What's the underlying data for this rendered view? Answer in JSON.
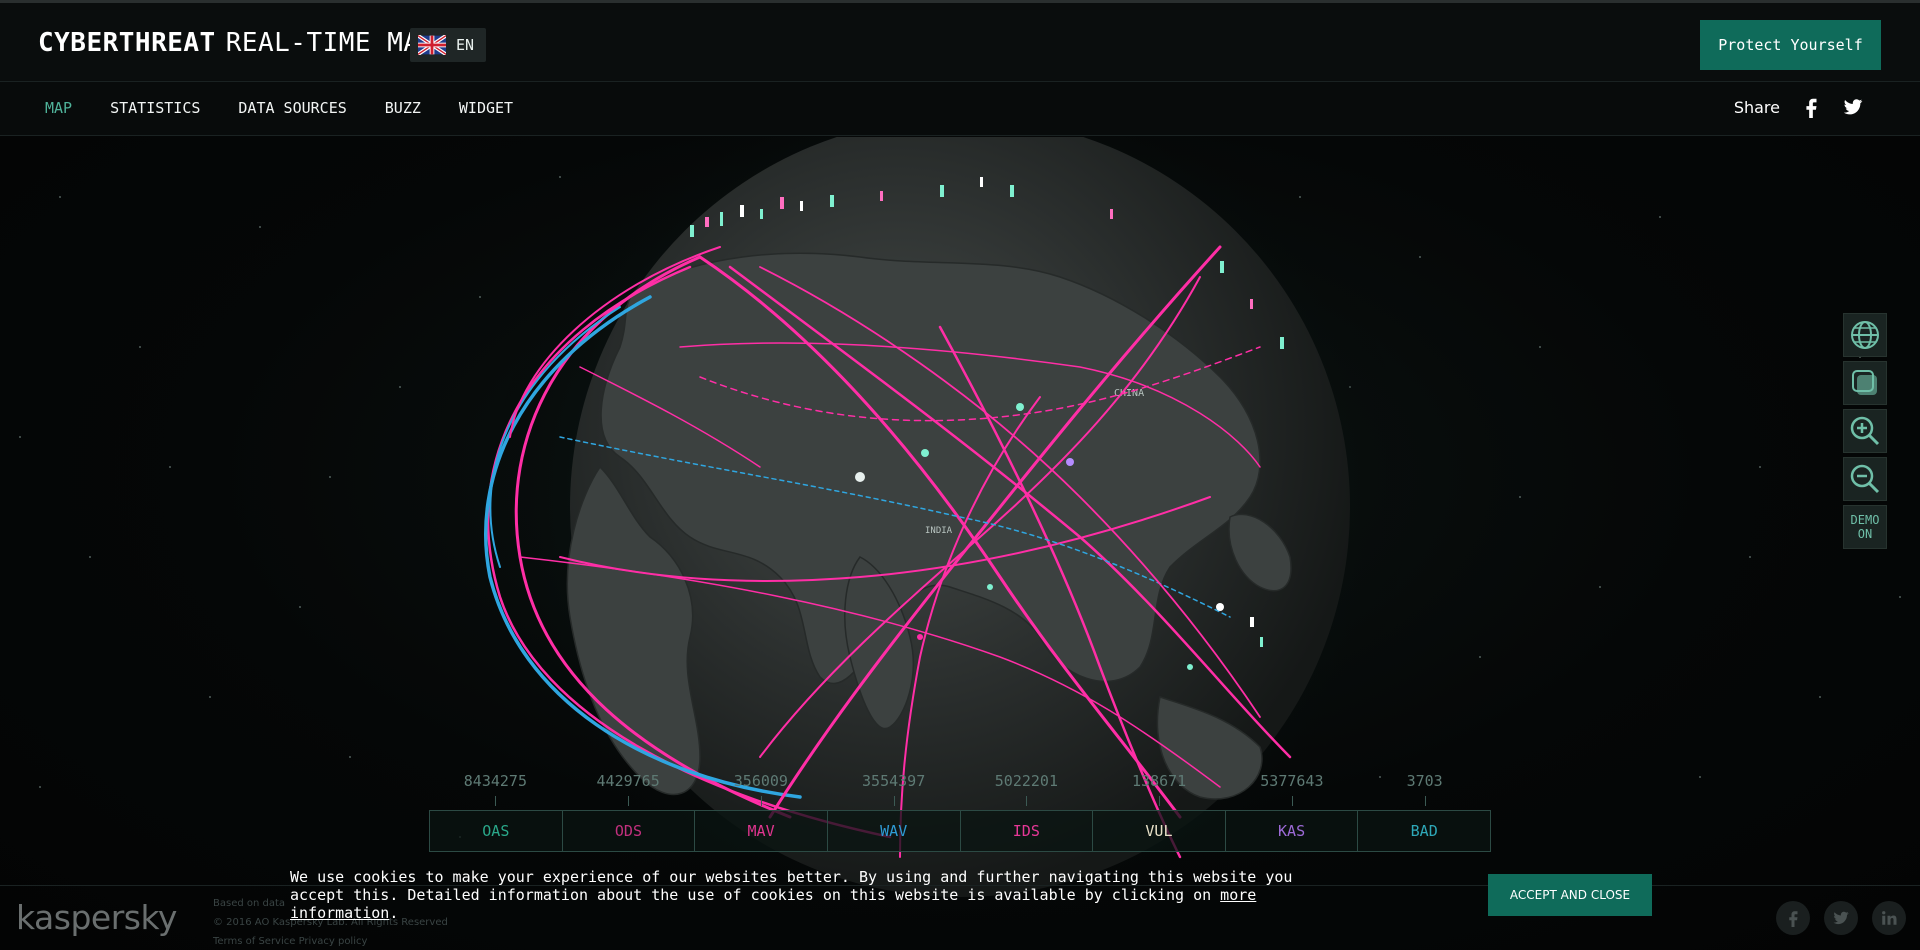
{
  "header": {
    "brand_bold": "CYBERTHREAT",
    "brand_rest": "REAL-TIME MAP",
    "language": "EN",
    "protect_button": "Protect Yourself"
  },
  "nav": {
    "items": [
      {
        "label": "MAP",
        "active": true
      },
      {
        "label": "STATISTICS",
        "active": false
      },
      {
        "label": "DATA SOURCES",
        "active": false
      },
      {
        "label": "BUZZ",
        "active": false
      },
      {
        "label": "WIDGET",
        "active": false
      }
    ],
    "share_label": "Share"
  },
  "map": {
    "labels": {
      "china": "CHINA",
      "india": "INDIA"
    },
    "controls": {
      "demo_label": "DEMO\nON"
    }
  },
  "counters": [
    {
      "value": "8434275",
      "label": "OAS",
      "color": "#2aa88a"
    },
    {
      "value": "4429765",
      "label": "ODS",
      "color": "#c2307e"
    },
    {
      "value": "356009",
      "label": "MAV",
      "color": "#e0358f"
    },
    {
      "value": "3554397",
      "label": "WAV",
      "color": "#2f9bd6"
    },
    {
      "value": "5022201",
      "label": "IDS",
      "color": "#e63897"
    },
    {
      "value": "138671",
      "label": "VUL",
      "color": "#e8e1c8"
    },
    {
      "value": "5377643",
      "label": "KAS",
      "color": "#9c6ad6"
    },
    {
      "value": "3703",
      "label": "BAD",
      "color": "#2ea8b8"
    }
  ],
  "cookie": {
    "text_before": "We use cookies to make your experience of our websites better. By using and further navigating this website you accept this. Detailed information about the use of cookies on this website is available by clicking on ",
    "link": "more information",
    "text_after": ".",
    "button": "ACCEPT AND CLOSE"
  },
  "footer": {
    "logo": "kaspersky",
    "line1": "Based on data",
    "line2": "© 2016 AO Kaspersky Lab. All Rights Reserved",
    "line3": "Terms of Service   Privacy policy"
  },
  "colors": {
    "accent": "#0f6b5a",
    "active_nav": "#4fb39a",
    "attack_pink": "#ff2ea6",
    "attack_blue": "#2fa6e0"
  }
}
